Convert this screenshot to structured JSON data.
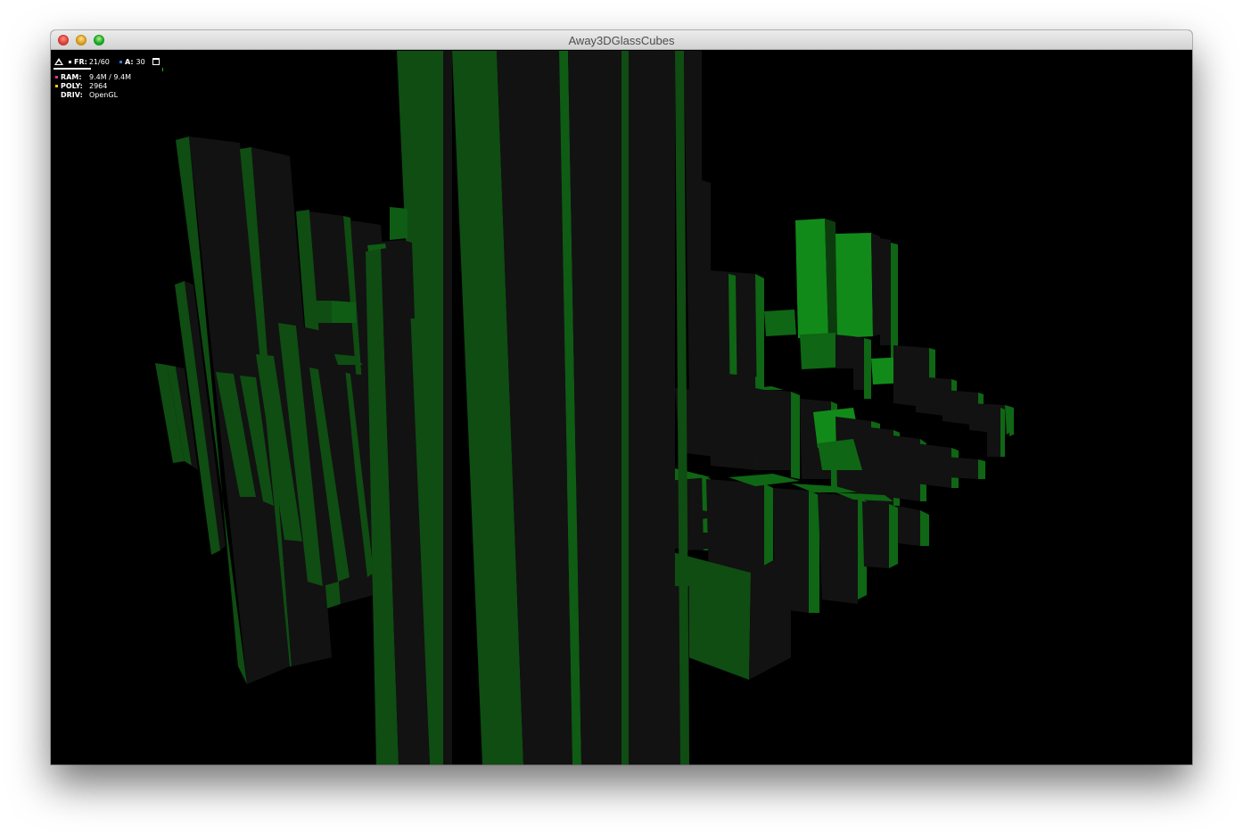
{
  "window": {
    "title": "Away3DGlassCubes"
  },
  "stats": {
    "fr_label": "FR:",
    "fr_value": "21/60",
    "fr_fraction": 0.35,
    "a_label": "A:",
    "a_value": "30",
    "ram_label": "RAM:",
    "ram_value": "9.4M / 9.4M",
    "poly_label": "POLY:",
    "poly_value": "2964",
    "driv_label": "DRIV:",
    "driv_value": "OpenGL",
    "colors": {
      "fr": "#ffffff",
      "a": "#3a7bd5",
      "ram": "#e8308c",
      "poly": "#f0c419"
    }
  },
  "scene": {
    "background": "#000000",
    "cube_dark": "#121212",
    "cube_green": "#0f4d12",
    "cube_green_bright": "#117a18"
  }
}
